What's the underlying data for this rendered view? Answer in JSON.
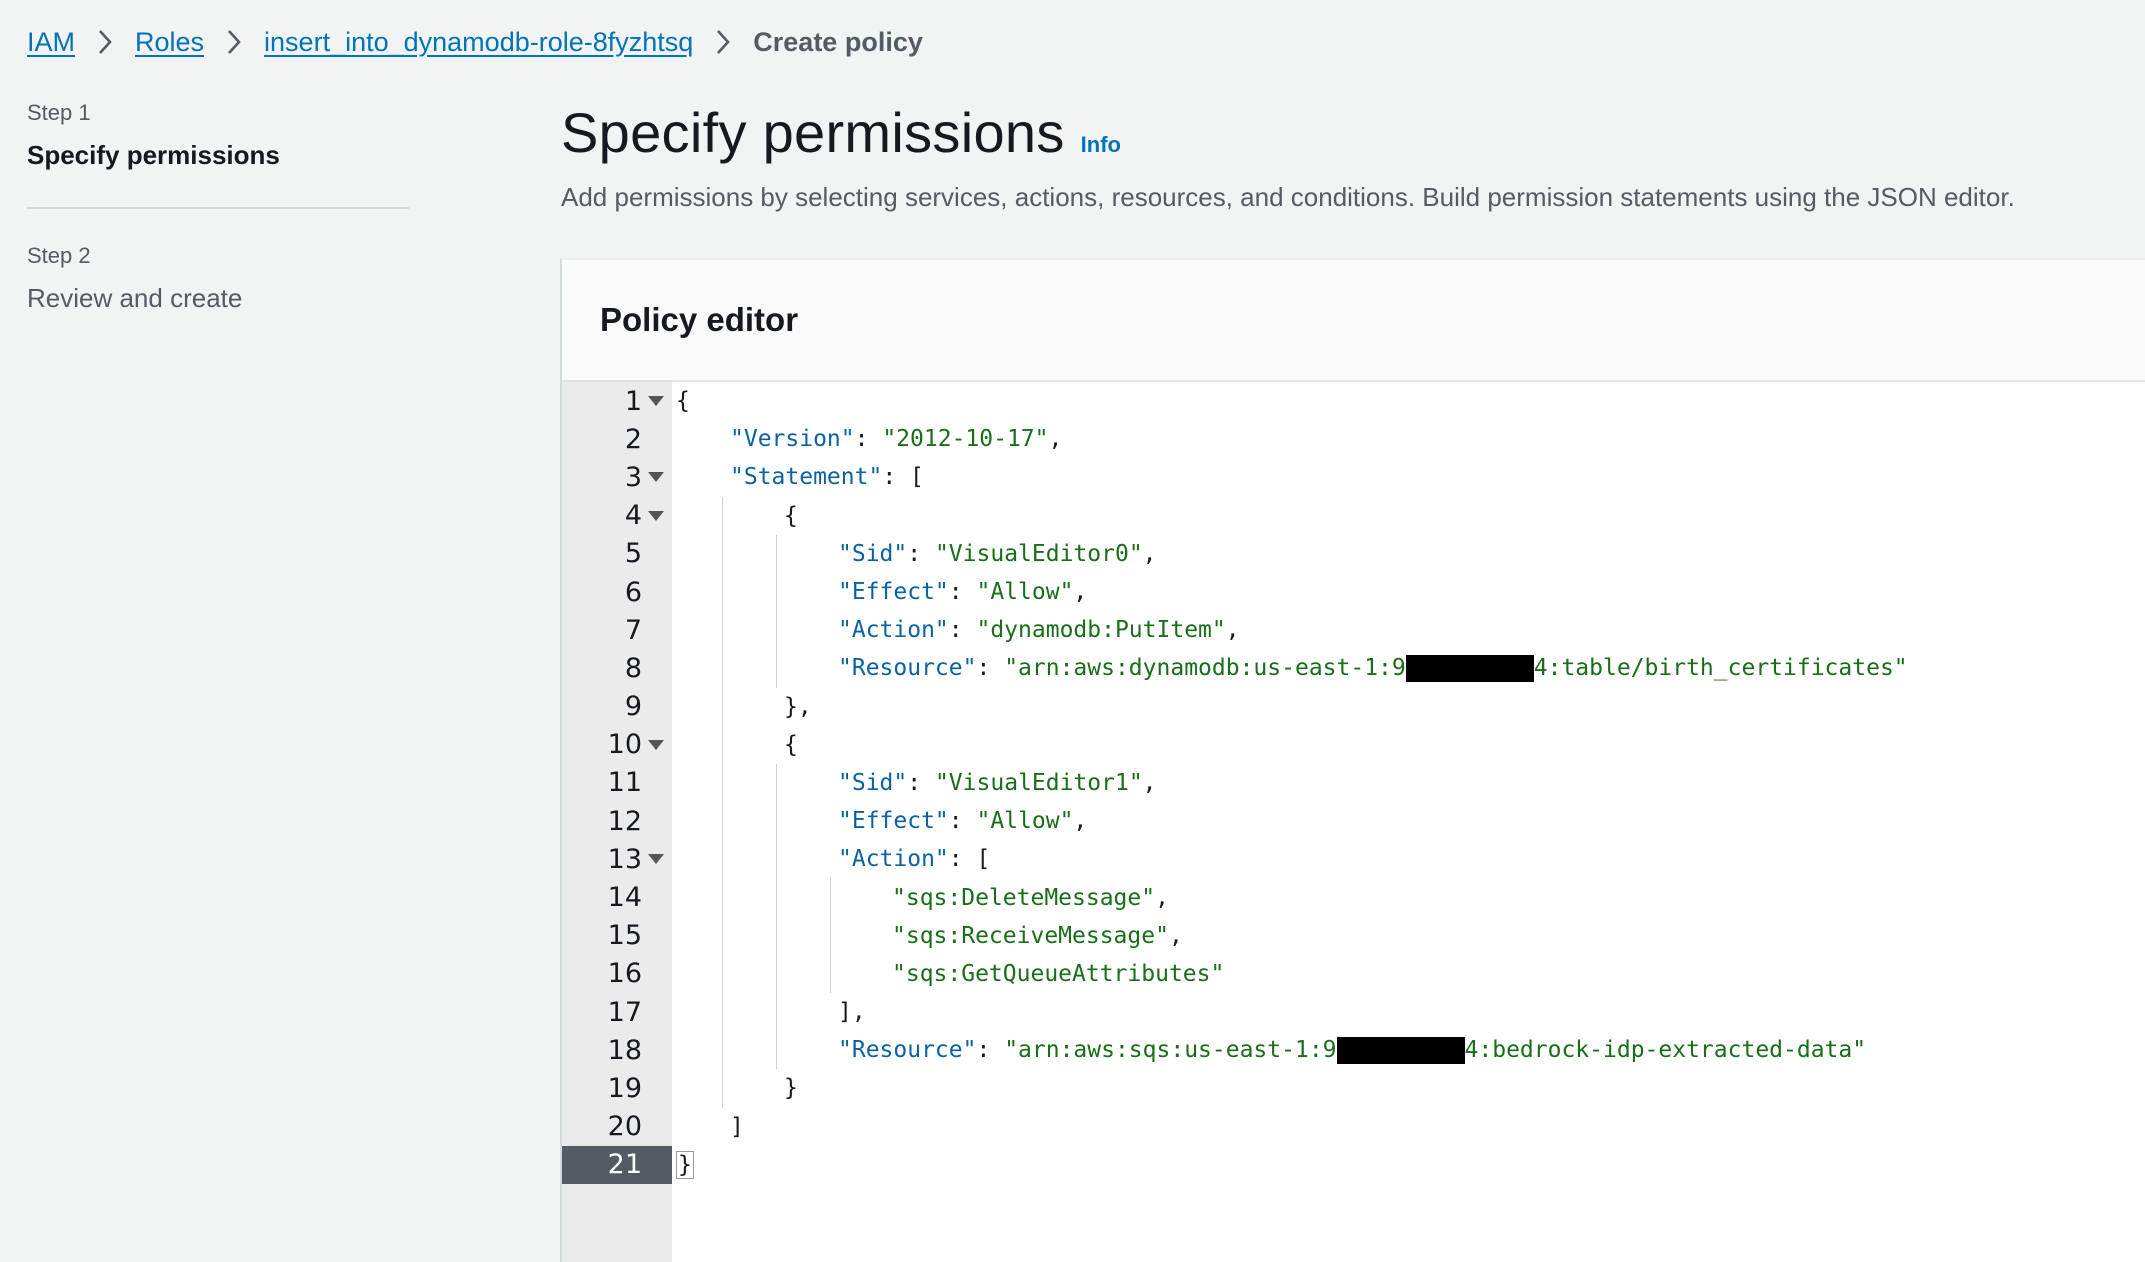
{
  "breadcrumb": {
    "items": [
      "IAM",
      "Roles",
      "insert_into_dynamodb-role-8fyzhtsq"
    ],
    "current": "Create policy"
  },
  "steps": [
    {
      "label": "Step 1",
      "title": "Specify permissions",
      "active": true
    },
    {
      "label": "Step 2",
      "title": "Review and create",
      "active": false
    }
  ],
  "header": {
    "title": "Specify permissions",
    "info_label": "Info",
    "description": "Add permissions by selecting services, actions, resources, and conditions. Build permission statements using the JSON editor."
  },
  "policy_editor": {
    "title": "Policy editor",
    "active_line": 21,
    "colors": {
      "key": "#0b62a3",
      "string": "#1a6e1a",
      "gutter": "#ebebeb",
      "active_gutter": "#545b64"
    },
    "lines": [
      {
        "n": "1",
        "fold": true,
        "indent": 0,
        "segments": [
          {
            "t": "p",
            "v": "{"
          }
        ]
      },
      {
        "n": "2",
        "fold": false,
        "indent": 1,
        "segments": [
          {
            "t": "k",
            "v": "\"Version\""
          },
          {
            "t": "p",
            "v": ": "
          },
          {
            "t": "s",
            "v": "\"2012-10-17\""
          },
          {
            "t": "p",
            "v": ","
          }
        ]
      },
      {
        "n": "3",
        "fold": true,
        "indent": 1,
        "segments": [
          {
            "t": "k",
            "v": "\"Statement\""
          },
          {
            "t": "p",
            "v": ": ["
          }
        ]
      },
      {
        "n": "4",
        "fold": true,
        "indent": 2,
        "segments": [
          {
            "t": "p",
            "v": "{"
          }
        ]
      },
      {
        "n": "5",
        "fold": false,
        "indent": 3,
        "segments": [
          {
            "t": "k",
            "v": "\"Sid\""
          },
          {
            "t": "p",
            "v": ": "
          },
          {
            "t": "s",
            "v": "\"VisualEditor0\""
          },
          {
            "t": "p",
            "v": ","
          }
        ]
      },
      {
        "n": "6",
        "fold": false,
        "indent": 3,
        "segments": [
          {
            "t": "k",
            "v": "\"Effect\""
          },
          {
            "t": "p",
            "v": ": "
          },
          {
            "t": "s",
            "v": "\"Allow\""
          },
          {
            "t": "p",
            "v": ","
          }
        ]
      },
      {
        "n": "7",
        "fold": false,
        "indent": 3,
        "segments": [
          {
            "t": "k",
            "v": "\"Action\""
          },
          {
            "t": "p",
            "v": ": "
          },
          {
            "t": "s",
            "v": "\"dynamodb:PutItem\""
          },
          {
            "t": "p",
            "v": ","
          }
        ]
      },
      {
        "n": "8",
        "fold": false,
        "indent": 3,
        "segments": [
          {
            "t": "k",
            "v": "\"Resource\""
          },
          {
            "t": "p",
            "v": ": "
          },
          {
            "t": "s",
            "v": "\"arn:aws:dynamodb:us-east-1:9"
          },
          {
            "t": "r",
            "v": ""
          },
          {
            "t": "s",
            "v": "4:table/birth_certificates\""
          }
        ]
      },
      {
        "n": "9",
        "fold": false,
        "indent": 2,
        "segments": [
          {
            "t": "p",
            "v": "},"
          }
        ]
      },
      {
        "n": "10",
        "fold": true,
        "indent": 2,
        "segments": [
          {
            "t": "p",
            "v": "{"
          }
        ]
      },
      {
        "n": "11",
        "fold": false,
        "indent": 3,
        "segments": [
          {
            "t": "k",
            "v": "\"Sid\""
          },
          {
            "t": "p",
            "v": ": "
          },
          {
            "t": "s",
            "v": "\"VisualEditor1\""
          },
          {
            "t": "p",
            "v": ","
          }
        ]
      },
      {
        "n": "12",
        "fold": false,
        "indent": 3,
        "segments": [
          {
            "t": "k",
            "v": "\"Effect\""
          },
          {
            "t": "p",
            "v": ": "
          },
          {
            "t": "s",
            "v": "\"Allow\""
          },
          {
            "t": "p",
            "v": ","
          }
        ]
      },
      {
        "n": "13",
        "fold": true,
        "indent": 3,
        "segments": [
          {
            "t": "k",
            "v": "\"Action\""
          },
          {
            "t": "p",
            "v": ": ["
          }
        ]
      },
      {
        "n": "14",
        "fold": false,
        "indent": 4,
        "segments": [
          {
            "t": "s",
            "v": "\"sqs:DeleteMessage\""
          },
          {
            "t": "p",
            "v": ","
          }
        ]
      },
      {
        "n": "15",
        "fold": false,
        "indent": 4,
        "segments": [
          {
            "t": "s",
            "v": "\"sqs:ReceiveMessage\""
          },
          {
            "t": "p",
            "v": ","
          }
        ]
      },
      {
        "n": "16",
        "fold": false,
        "indent": 4,
        "segments": [
          {
            "t": "s",
            "v": "\"sqs:GetQueueAttributes\""
          }
        ]
      },
      {
        "n": "17",
        "fold": false,
        "indent": 3,
        "segments": [
          {
            "t": "p",
            "v": "],"
          }
        ]
      },
      {
        "n": "18",
        "fold": false,
        "indent": 3,
        "segments": [
          {
            "t": "k",
            "v": "\"Resource\""
          },
          {
            "t": "p",
            "v": ": "
          },
          {
            "t": "s",
            "v": "\"arn:aws:sqs:us-east-1:9"
          },
          {
            "t": "r",
            "v": ""
          },
          {
            "t": "s",
            "v": "4:bedrock-idp-extracted-data\""
          }
        ]
      },
      {
        "n": "19",
        "fold": false,
        "indent": 2,
        "segments": [
          {
            "t": "p",
            "v": "}"
          }
        ]
      },
      {
        "n": "20",
        "fold": false,
        "indent": 1,
        "segments": [
          {
            "t": "p",
            "v": "]"
          }
        ]
      },
      {
        "n": "21",
        "fold": false,
        "indent": 0,
        "segments": [
          {
            "t": "c",
            "v": "}"
          }
        ]
      }
    ]
  }
}
